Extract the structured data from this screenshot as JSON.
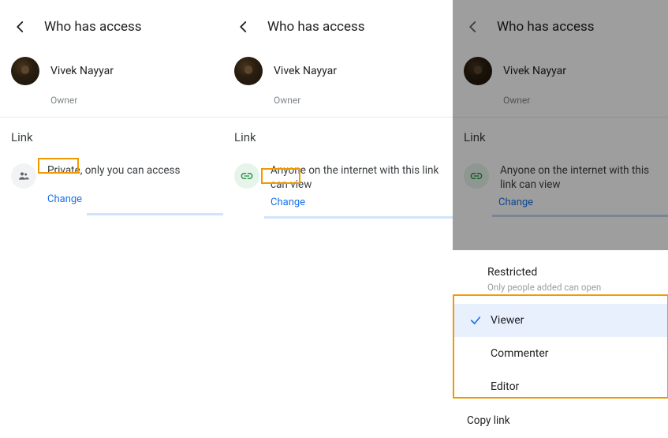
{
  "panel1": {
    "title": "Who has access",
    "user": {
      "name": "Vivek Nayyar",
      "role": "Owner"
    },
    "link_section": "Link",
    "link_text": "Private, only you can access",
    "change": "Change"
  },
  "panel2": {
    "title": "Who has access",
    "user": {
      "name": "Vivek Nayyar",
      "role": "Owner"
    },
    "link_section": "Link",
    "link_text": "Anyone on the internet with this link can view",
    "change": "Change"
  },
  "panel3": {
    "title": "Who has access",
    "user": {
      "name": "Vivek Nayyar",
      "role": "Owner"
    },
    "link_section": "Link",
    "link_text": "Anyone on the internet with this link can view",
    "change": "Change",
    "sheet": {
      "restricted": "Restricted",
      "restricted_sub": "Only people added can open",
      "options": [
        "Viewer",
        "Commenter",
        "Editor"
      ],
      "copy": "Copy link"
    }
  }
}
